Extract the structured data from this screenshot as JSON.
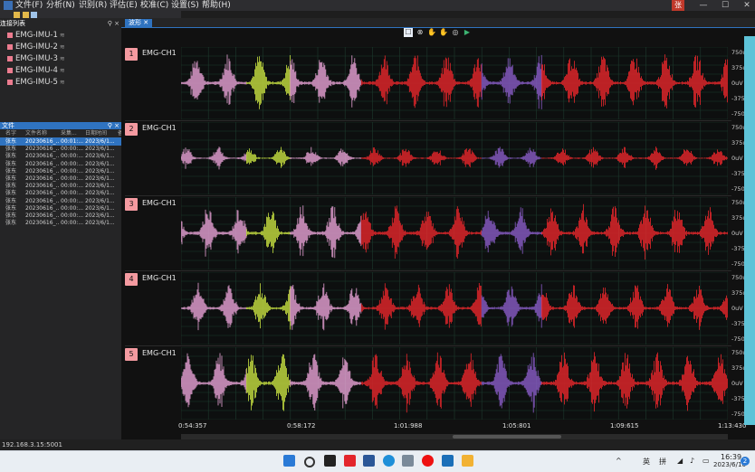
{
  "menu": {
    "items": [
      "文件(F)",
      "分析(N)",
      "识别(R)",
      "评估(E)",
      "校准(C)",
      "设置(S)",
      "帮助(H)"
    ],
    "user_badge": "张"
  },
  "window_controls": {
    "minimize": "—",
    "maximize": "☐",
    "close": "✕"
  },
  "devices": {
    "header": "连接列表",
    "items": [
      "EMG-IMU-1",
      "EMG-IMU-2",
      "EMG-IMU-3",
      "EMG-IMU-4",
      "EMG-IMU-5"
    ],
    "signal_icon": "wifi-signal-icon",
    "pin_icon": "⚲ ×"
  },
  "files": {
    "header": "文件",
    "pin_icon": "⚲ ×",
    "columns": [
      "名字",
      "文件名称",
      "采集...",
      "日期时间",
      "备"
    ],
    "rows": [
      [
        "张东",
        "20230616_...",
        "00:01:...",
        "2023/6/1..."
      ],
      [
        "张东",
        "20230616_...",
        "00:00:...",
        "2023/6/1..."
      ],
      [
        "张东",
        "20230616_...",
        "00:00:...",
        "2023/6/1..."
      ],
      [
        "张东",
        "20230616_...",
        "00:00:...",
        "2023/6/1..."
      ],
      [
        "张东",
        "20230616_...",
        "00:00:...",
        "2023/6/1..."
      ],
      [
        "张东",
        "20230616_...",
        "00:00:...",
        "2023/6/1..."
      ],
      [
        "张东",
        "20230616_...",
        "00:00:...",
        "2023/6/1..."
      ],
      [
        "张东",
        "20230616_...",
        "00:00:...",
        "2023/6/1..."
      ],
      [
        "张东",
        "20230616_...",
        "00:00:...",
        "2023/6/1..."
      ],
      [
        "张东",
        "20230616_...",
        "00:00:...",
        "2023/6/1..."
      ],
      [
        "张东",
        "20230616_...",
        "00:00:...",
        "2023/6/1..."
      ],
      [
        "张东",
        "20230616_...",
        "00:00:...",
        "2023/6/1..."
      ]
    ],
    "selected_row": 0
  },
  "tab": {
    "label": "波形",
    "close": "✕"
  },
  "wave_tools": [
    "☐",
    "⊗",
    "✋",
    "✋",
    "◎",
    "▶"
  ],
  "channels": [
    {
      "index": "1",
      "name": "EMG-CH1"
    },
    {
      "index": "2",
      "name": "EMG-CH1"
    },
    {
      "index": "3",
      "name": "EMG-CH1"
    },
    {
      "index": "4",
      "name": "EMG-CH1"
    },
    {
      "index": "5",
      "name": "EMG-CH1"
    }
  ],
  "y_axis_labels": [
    "750uV",
    "375uV",
    "0uV",
    "-375uV",
    "-750uV"
  ],
  "x_axis_labels": [
    "0:54:357",
    "0:58:172",
    "1:01:988",
    "1:05:801",
    "1:09:615",
    "1:13:430"
  ],
  "trace_colors": {
    "pink": "#e9a2d6",
    "yellow": "#c8e040",
    "red": "#e8262b",
    "purple": "#8a5cc8"
  },
  "status": {
    "address": "192.168.3.15:5001"
  },
  "taskbar": {
    "tray_up": "^",
    "ime_lang": "英",
    "ime_mode": "拼",
    "time": "16:39",
    "date": "2023/6/16",
    "notify_count": "2"
  }
}
